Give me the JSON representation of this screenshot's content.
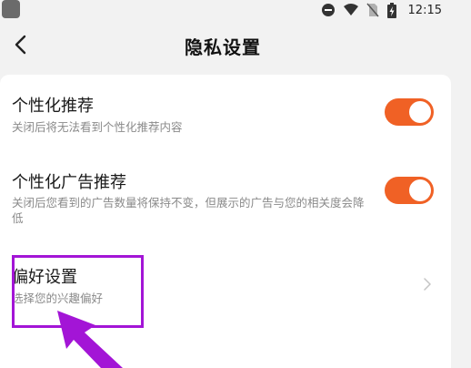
{
  "status_bar": {
    "time": "12:15",
    "icons": [
      "app-icon",
      "minus-circle-icon",
      "wifi-icon",
      "no-sim-icon",
      "battery-charging-icon"
    ]
  },
  "header": {
    "title": "隐私设置",
    "back_icon": "chevron-left-icon"
  },
  "settings": [
    {
      "title": "个性化推荐",
      "desc": "关闭后将无法看到个性化推荐内容",
      "control": "toggle",
      "on": true
    },
    {
      "title": "个性化广告推荐",
      "desc": "关闭后您看到的广告数量将保持不变，但展示的广告与您的相关度会降低",
      "control": "toggle",
      "on": true
    },
    {
      "title": "偏好设置",
      "desc": "选择您的兴趣偏好",
      "control": "chevron-right-icon"
    }
  ],
  "colors": {
    "toggle_on": "#f06125",
    "highlight": "#a315d6",
    "background": "#f2f2f2",
    "card": "#ffffff"
  }
}
